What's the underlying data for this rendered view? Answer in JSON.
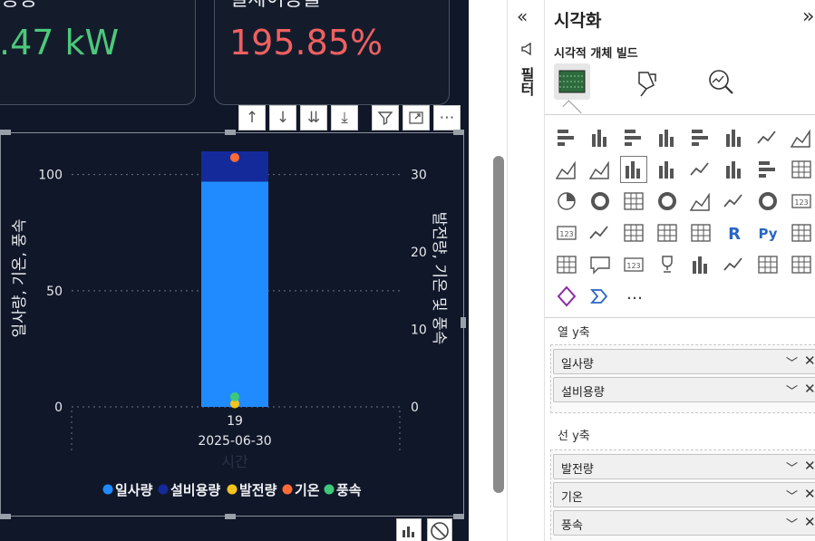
{
  "kpi_cards": [
    {
      "title": "용량",
      "value": ".47 kW",
      "value_color": "#4cc97a"
    },
    {
      "title": "설제이용률",
      "value": "195.85%",
      "value_color": "#f06060"
    }
  ],
  "visual_toolbar": {
    "items": [
      "↑",
      "↓",
      "⇊",
      "⤓",
      "filter",
      "focus",
      "⋯"
    ]
  },
  "chart_data": {
    "type": "bar",
    "categories": [
      "19 2025-06-30"
    ],
    "x_tick_day": "19",
    "x_tick_date": "2025-06-30",
    "xlabel": "시간",
    "ylabel": "일사량, 기온, 풍속",
    "y2label": "발전량, 기온 및 풍속",
    "ylim": [
      0,
      110
    ],
    "y2lim": [
      0,
      33
    ],
    "y_ticks": [
      "0",
      "50",
      "100"
    ],
    "y2_ticks": [
      "0",
      "10",
      "20",
      "30"
    ],
    "stacked_bars": [
      {
        "name": "일사량",
        "values": [
          97
        ],
        "color": "#1f8bff"
      },
      {
        "name": "설비용량",
        "values": [
          13
        ],
        "color": "#152a9a"
      }
    ],
    "line_points": [
      {
        "name": "발전량",
        "axis": "y2",
        "values": [
          0.4
        ],
        "color": "#f5c31c"
      },
      {
        "name": "기온",
        "axis": "y2",
        "values": [
          32.2
        ],
        "color": "#ff6b35"
      },
      {
        "name": "풍속",
        "axis": "y2",
        "values": [
          1.3
        ],
        "color": "#3ec879"
      }
    ],
    "legend": [
      "일사량",
      "설비용량",
      "발전량",
      "기온",
      "풍속"
    ],
    "legend_position": "bottom-center",
    "grid": true
  },
  "collapsed_pane": {
    "label": "필터"
  },
  "viz_pane": {
    "title": "시각화",
    "build_title": "시각적 개체 빌드",
    "more_label": "…",
    "column_y_label": "열 y축",
    "column_y_fields": [
      "일사량",
      "설비용량"
    ],
    "line_y_label": "선 y축",
    "line_y_fields": [
      "발전량",
      "기온",
      "풍속"
    ]
  },
  "colors": {
    "canvas_bg": "#0f1728",
    "accent_green": "#4cc97a",
    "accent_red": "#f06060"
  }
}
